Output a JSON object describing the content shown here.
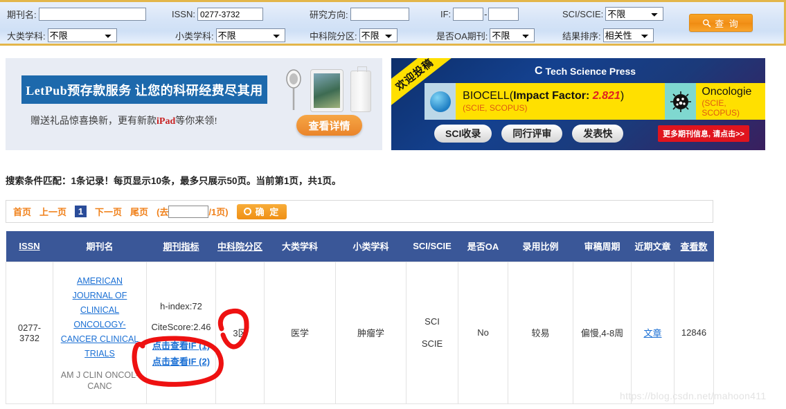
{
  "search": {
    "fields": [
      {
        "label": "期刊名:",
        "type": "text",
        "value": "",
        "name": "journal-name"
      },
      {
        "label": "ISSN:",
        "type": "text",
        "value": "0277-3732",
        "name": "issn"
      },
      {
        "label": "研究方向:",
        "type": "text",
        "value": "",
        "name": "research-direction"
      },
      {
        "label": "IF:",
        "type": "range",
        "value": "",
        "value2": "",
        "separator": "-",
        "name": "impact-factor"
      },
      {
        "label": "SCI/SCIE:",
        "type": "select",
        "value": "不限",
        "name": "sci-scie"
      },
      {
        "label": "大类学科:",
        "type": "select",
        "value": "不限",
        "name": "major-category"
      },
      {
        "label": "小类学科:",
        "type": "select",
        "value": "不限",
        "name": "minor-category"
      },
      {
        "label": "中科院分区:",
        "type": "select",
        "value": "不限",
        "name": "cas-zone"
      },
      {
        "label": "是否OA期刊:",
        "type": "select",
        "value": "不限",
        "name": "is-oa"
      },
      {
        "label": "结果排序:",
        "type": "select",
        "value": "相关性",
        "name": "sort-order"
      }
    ],
    "options": [
      "不限"
    ],
    "sort_options": [
      "相关性"
    ],
    "query_button": "查 询",
    "query_icon": "search-icon"
  },
  "banner_left": {
    "headline": "LetPub预存款服务 让您的科研经费尽其用",
    "subline_pre": "赠送礼品惊喜换新，更有新款",
    "subline_em": "iPad",
    "subline_post": "等你来领!",
    "cta": "查看详情"
  },
  "banner_right": {
    "ribbon": "欢迎投稿",
    "publisher": "Tech Science Press",
    "journal1_name": "BIOCELL(",
    "journal1_if_label": "Impact Factor: ",
    "journal1_if_value": "2.821",
    "journal1_close": ")",
    "journal1_index": "(SCIE, SCOPUS)",
    "journal2_name": "Oncologie",
    "journal2_index": "(SCIE, SCOPUS)",
    "pills": [
      "SCI收录",
      "同行评审",
      "发表快"
    ],
    "more_button": "更多期刊信息, 请点击>>"
  },
  "results": {
    "summary": "搜索条件匹配：1条记录！每页显示10条，最多只展示50页。当前第1页，共1页。"
  },
  "pagination": {
    "first": "首页",
    "prev": "上一页",
    "current": "1",
    "next": "下一页",
    "last": "尾页",
    "goto_prefix": "(去",
    "goto_value": "",
    "goto_suffix": "/1页)",
    "confirm": "确 定"
  },
  "table": {
    "headers": [
      {
        "label": "ISSN",
        "underline": true
      },
      {
        "label": "期刊名",
        "underline": false
      },
      {
        "label": "期刊指标",
        "underline": true
      },
      {
        "label": "中科院分区",
        "underline": true
      },
      {
        "label": "大类学科",
        "underline": false
      },
      {
        "label": "小类学科",
        "underline": false
      },
      {
        "label": "SCI/SCIE",
        "underline": false
      },
      {
        "label": "是否OA",
        "underline": false
      },
      {
        "label": "录用比例",
        "underline": false
      },
      {
        "label": "审稿周期",
        "underline": false
      },
      {
        "label": "近期文章",
        "underline": false
      },
      {
        "label": "查看数",
        "underline": true
      }
    ],
    "rows": [
      {
        "issn": "0277-3732",
        "journal_name_lines": [
          "AMERICAN",
          "JOURNAL OF",
          "CLINICAL",
          "ONCOLOGY-",
          "CANCER CLINICAL",
          "TRIALS"
        ],
        "journal_abbr": "AM J CLIN ONCOL-CANC",
        "h_index": "h-index:72",
        "citescore": "CiteScore:2.46",
        "if_link_1": "点击查看IF (1)",
        "if_link_2": "点击查看IF (2)",
        "cas_zone": "3区",
        "major_category": "医学",
        "minor_category": "肿瘤学",
        "sci_scie": [
          "SCI",
          "SCIE"
        ],
        "is_oa": "No",
        "accept_rate": "较易",
        "review_cycle": "偏慢,4-8周",
        "recent_articles": "文章",
        "view_count": "12846"
      }
    ]
  },
  "watermark": "https://blog.csdn.net/mahoon411",
  "colors": {
    "accent_orange": "#f08019",
    "header_blue": "#3a5798",
    "link_blue": "#1a6fd4",
    "annotation_red": "#ee1111",
    "panel_border_gold": "#e3b64a"
  }
}
